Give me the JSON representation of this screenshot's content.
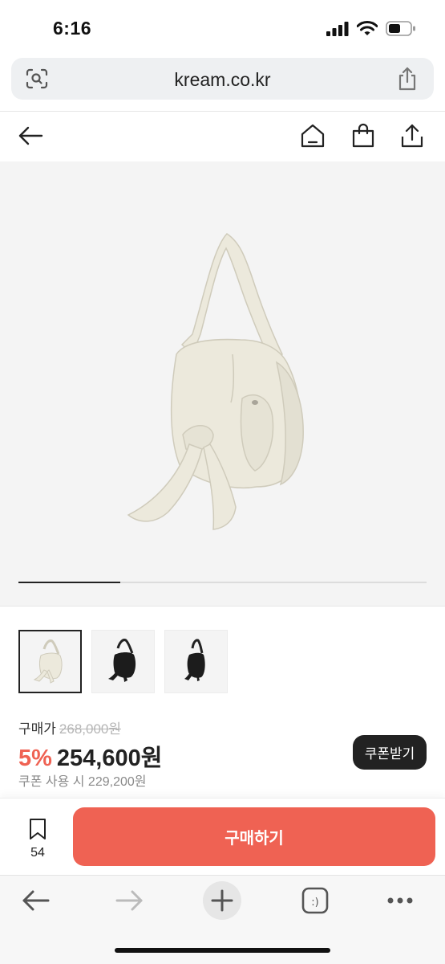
{
  "status": {
    "time": "6:16"
  },
  "browser": {
    "url": "kream.co.kr"
  },
  "gallery": {
    "progress": 0.25,
    "thumbnails": [
      "ivory",
      "black",
      "black-2"
    ]
  },
  "pricing": {
    "label": "구매가",
    "original_price": "268,000원",
    "discount": "5%",
    "price": "254,600원",
    "coupon_text": "쿠폰 사용 시 229,200원",
    "coupon_button": "쿠폰받기"
  },
  "action": {
    "bookmark_count": "54",
    "buy_label": "구매하기"
  },
  "colors": {
    "accent": "#ef6253",
    "dark": "#222222"
  }
}
